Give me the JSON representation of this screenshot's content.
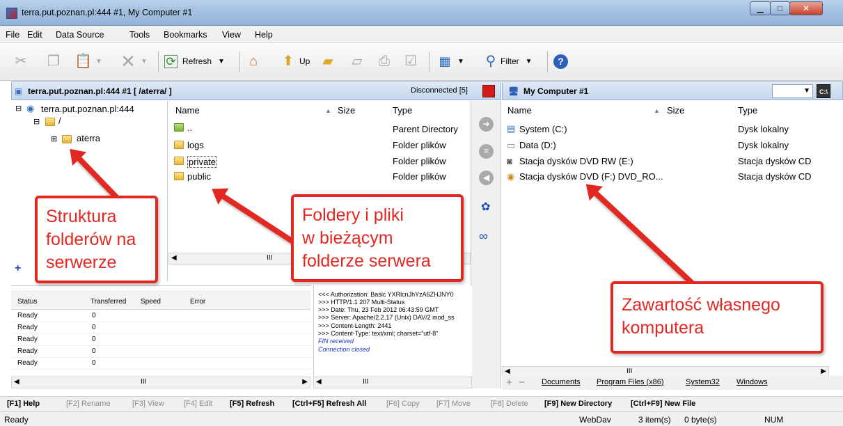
{
  "window": {
    "title": "terra.put.poznan.pl:444 #1, My Computer #1",
    "min_symbol": "▁",
    "max_symbol": "□",
    "close_symbol": "✕"
  },
  "menu": [
    "File",
    "Edit",
    "Data Source",
    "Tools",
    "Bookmarks",
    "View",
    "Help"
  ],
  "toolbar": {
    "refresh_label": "Refresh",
    "up_label": "Up",
    "filter_label": "Filter"
  },
  "left_pane": {
    "header": "terra.put.poznan.pl:444 #1   [ /aterra/ ]",
    "status": "Disconnected [5]",
    "tree": {
      "root": "terra.put.poznan.pl:444",
      "slash": "/",
      "child": "aterra"
    },
    "columns": {
      "name": "Name",
      "size": "Size",
      "type": "Type"
    },
    "rows": [
      {
        "name": "..",
        "type": "Parent Directory"
      },
      {
        "name": "logs",
        "type": "Folder plików"
      },
      {
        "name": "private",
        "type": "Folder plików"
      },
      {
        "name": "public",
        "type": "Folder plików"
      }
    ],
    "scroll_mark": "III"
  },
  "right_pane": {
    "header": "My Computer #1",
    "columns": {
      "name": "Name",
      "size": "Size",
      "type": "Type"
    },
    "rows": [
      {
        "name": "System (C:)",
        "type": "Dysk lokalny"
      },
      {
        "name": "Data (D:)",
        "type": "Dysk lokalny"
      },
      {
        "name": "Stacja dysków DVD RW (E:)",
        "type": "Stacja dysków CD"
      },
      {
        "name": "Stacja dysków DVD (F:) DVD_RO...",
        "type": "Stacja dysków CD"
      }
    ],
    "tabs": [
      "Documents",
      "Program Files (x86)",
      "System32",
      "Windows"
    ],
    "scroll_mark": "III"
  },
  "queue": {
    "columns": [
      "Status",
      "Transferred",
      "Speed",
      "Error"
    ],
    "rows": [
      {
        "status": "Ready",
        "transferred": "0"
      },
      {
        "status": "Ready",
        "transferred": "0"
      },
      {
        "status": "Ready",
        "transferred": "0"
      },
      {
        "status": "Ready",
        "transferred": "0"
      },
      {
        "status": "Ready",
        "transferred": "0"
      }
    ],
    "scroll_mark": "III"
  },
  "log": [
    {
      "text": "<<< Authorization: Basic YXRlcnJhYzA6ZHJNY0",
      "blue": false
    },
    {
      "text": ">>> HTTP/1.1 207 Multi-Status",
      "blue": false
    },
    {
      "text": ">>> Date: Thu, 23 Feb 2012 06:43:59 GMT",
      "blue": false
    },
    {
      "text": ">>> Server: Apache/2.2.17 (Unix) DAV/2 mod_ss",
      "blue": false
    },
    {
      "text": ">>> Content-Length: 2441",
      "blue": false
    },
    {
      "text": ">>> Content-Type: text/xml; charset=\"utf-8\"",
      "blue": false
    },
    {
      "text": "FIN received",
      "blue": true
    },
    {
      "text": "Connection closed",
      "blue": true
    }
  ],
  "fkeys": [
    {
      "label": "[F1] Help",
      "enabled": true
    },
    {
      "label": "[F2] Rename",
      "enabled": false
    },
    {
      "label": "[F3] View",
      "enabled": false
    },
    {
      "label": "[F4] Edit",
      "enabled": false
    },
    {
      "label": "[F5] Refresh",
      "enabled": true
    },
    {
      "label": "[Ctrl+F5] Refresh All",
      "enabled": true
    },
    {
      "label": "[F6] Copy",
      "enabled": false
    },
    {
      "label": "[F7] Move",
      "enabled": false
    },
    {
      "label": "[F8] Delete",
      "enabled": false
    },
    {
      "label": "[F9] New Directory",
      "enabled": true
    },
    {
      "label": "[Ctrl+F9] New File",
      "enabled": true
    }
  ],
  "status_bar": {
    "left": "Ready",
    "protocol": "WebDav",
    "items": "3 item(s)",
    "bytes": "0 byte(s)",
    "num": "NUM"
  },
  "annotations": {
    "tree": [
      "Struktura",
      "folderów na",
      "serwerze"
    ],
    "files": [
      "Foldery i pliki",
      "w bieżącym",
      "folderze serwera"
    ],
    "local": [
      "Zawartość własnego",
      "komputera"
    ]
  },
  "colors": {
    "accent_red": "#e32822",
    "header_blue": "#c3d6ec"
  }
}
